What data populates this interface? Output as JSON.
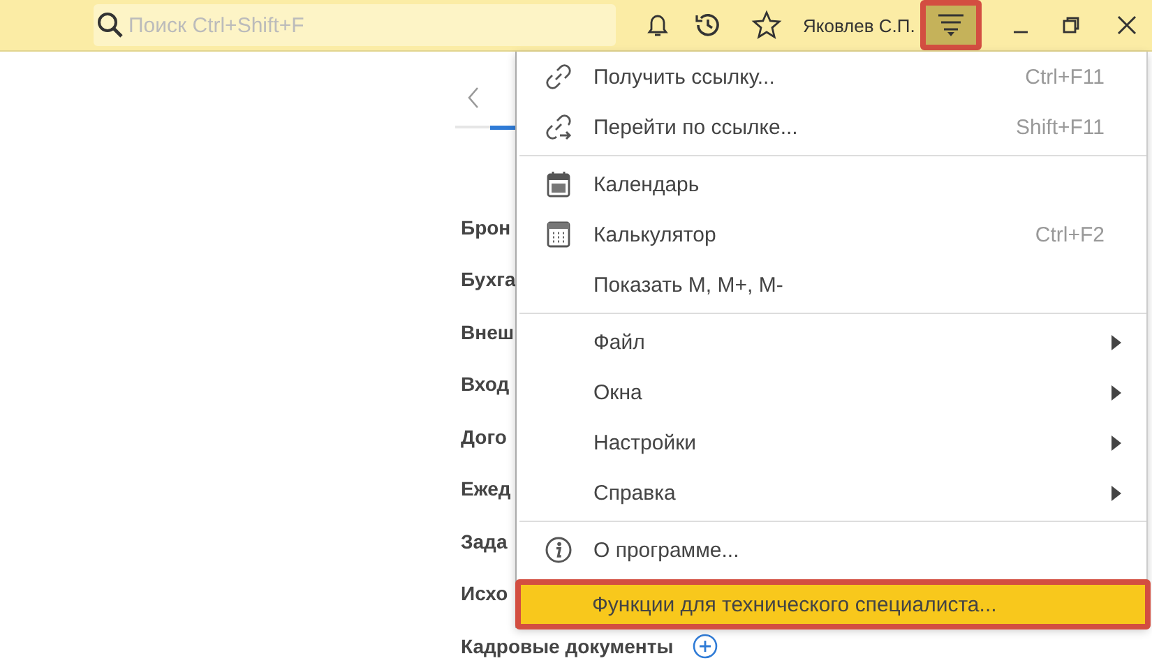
{
  "topbar": {
    "search": {
      "placeholder": "Поиск Ctrl+Shift+F"
    },
    "user": "Яковлев С.П.",
    "menu_button": {
      "highlighted": true
    }
  },
  "background": {
    "items": [
      {
        "label": "Брон"
      },
      {
        "label": "Бухга"
      },
      {
        "label": "Внеш"
      },
      {
        "label": "Вход"
      },
      {
        "label": "Дого"
      },
      {
        "label": "Ежед"
      },
      {
        "label": "Зада"
      },
      {
        "label": "Исхо"
      },
      {
        "label": "Кадровые документы",
        "add": true
      }
    ]
  },
  "menu": {
    "groups": [
      [
        {
          "label": "Получить ссылку...",
          "shortcut": "Ctrl+F11",
          "kind": "link",
          "highlighted": false
        },
        {
          "label": "Перейти по ссылке...",
          "shortcut": "Shift+F11",
          "kind": "link-go",
          "highlighted": false
        }
      ],
      [
        {
          "label": "Календарь",
          "kind": "calendar",
          "highlighted": false
        },
        {
          "label": "Калькулятор",
          "shortcut": "Ctrl+F2",
          "kind": "calculator",
          "highlighted": false
        },
        {
          "label": "Показать M, M+, M-",
          "highlighted": false
        }
      ],
      [
        {
          "label": "Файл",
          "submenu": true,
          "highlighted": false
        },
        {
          "label": "Окна",
          "submenu": true,
          "highlighted": false
        },
        {
          "label": "Настройки",
          "submenu": true,
          "highlighted": false
        },
        {
          "label": "Справка",
          "submenu": true,
          "highlighted": false
        }
      ],
      [
        {
          "label": "О программе...",
          "kind": "info",
          "highlighted": false
        },
        {
          "label": "Функции для технического специалиста...",
          "highlighted": true
        }
      ]
    ]
  }
}
